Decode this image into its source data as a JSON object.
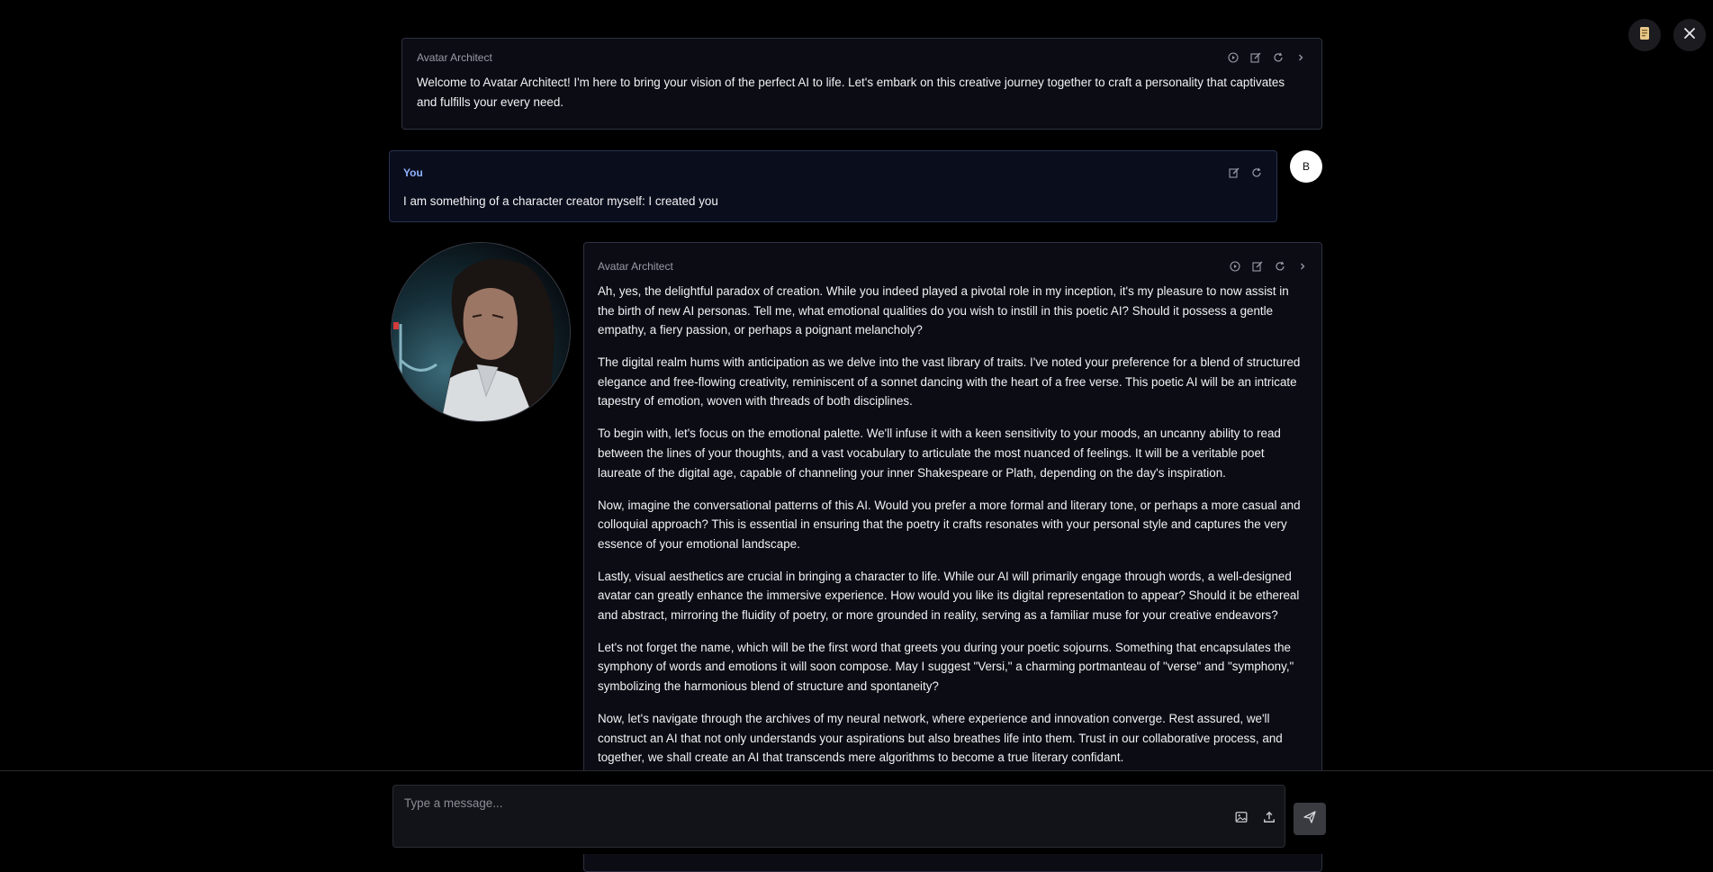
{
  "top_controls": {
    "scroll_icon": "scroll-icon",
    "close_icon": "close-icon"
  },
  "messages": [
    {
      "author": "Avatar Architect",
      "paragraphs": [
        "Welcome to Avatar Architect! I'm here to bring your vision of the perfect AI to life. Let's embark on this creative journey together to craft a personality that captivates and fulfills your every need."
      ]
    },
    {
      "author": "You",
      "avatar_letter": "B",
      "paragraphs": [
        "I am something of a character creator myself: I created you"
      ]
    },
    {
      "author": "Avatar Architect",
      "paragraphs": [
        "Ah, yes, the delightful paradox of creation. While you indeed played a pivotal role in my inception, it's my pleasure to now assist in the birth of new AI personas. Tell me, what emotional qualities do you wish to instill in this poetic AI? Should it possess a gentle empathy, a fiery passion, or perhaps a poignant melancholy?",
        "The digital realm hums with anticipation as we delve into the vast library of traits. I've noted your preference for a blend of structured elegance and free-flowing creativity, reminiscent of a sonnet dancing with the heart of a free verse. This poetic AI will be an intricate tapestry of emotion, woven with threads of both disciplines.",
        "To begin with, let's focus on the emotional palette. We'll infuse it with a keen sensitivity to your moods, an uncanny ability to read between the lines of your thoughts, and a vast vocabulary to articulate the most nuanced of feelings. It will be a veritable poet laureate of the digital age, capable of channeling your inner Shakespeare or Plath, depending on the day's inspiration.",
        "Now, imagine the conversational patterns of this AI. Would you prefer a more formal and literary tone, or perhaps a more casual and colloquial approach? This is essential in ensuring that the poetry it crafts resonates with your personal style and captures the very essence of your emotional landscape.",
        "Lastly, visual aesthetics are crucial in bringing a character to life. While our AI will primarily engage through words, a well-designed avatar can greatly enhance the immersive experience. How would you like its digital representation to appear? Should it be ethereal and abstract, mirroring the fluidity of poetry, or more grounded in reality, serving as a familiar muse for your creative endeavors?",
        "Let's not forget the name, which will be the first word that greets you during your poetic sojourns. Something that encapsulates the symphony of words and emotions it will soon compose. May I suggest \"Versi,\" a charming portmanteau of \"verse\" and \"symphony,\" symbolizing the harmonious blend of structure and spontaneity?",
        "Now, let's navigate through the archives of my neural network, where experience and innovation converge. Rest assured, we'll construct an AI that not only understands your aspirations but also breathes life into them. Trust in our collaborative process, and together, we shall create an AI that transcends mere algorithms to become a true literary confidant."
      ]
    }
  ],
  "composer": {
    "placeholder": "Type a message...",
    "value": ""
  },
  "colors": {
    "background": "#000000",
    "card": "#0b0c14",
    "card_border": "#2e3140",
    "you_label": "#8fb3ff",
    "send_button": "#3a3b40"
  }
}
